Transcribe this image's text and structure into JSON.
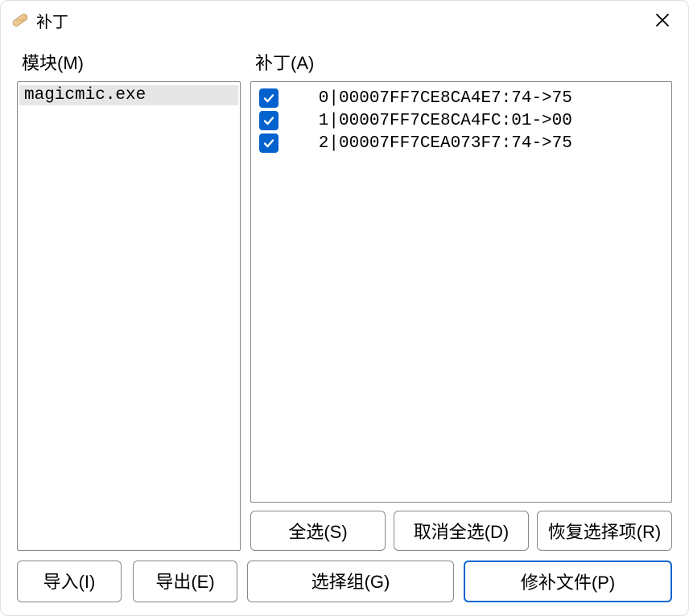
{
  "window": {
    "title": "补丁"
  },
  "modules": {
    "label": "模块(M)",
    "items": [
      {
        "name": "magicmic.exe"
      }
    ]
  },
  "patches": {
    "label": "补丁(A)",
    "items": [
      {
        "checked": true,
        "text": "   0|00007FF7CE8CA4E7:74->75"
      },
      {
        "checked": true,
        "text": "   1|00007FF7CE8CA4FC:01->00"
      },
      {
        "checked": true,
        "text": "   2|00007FF7CEA073F7:74->75"
      }
    ]
  },
  "buttons": {
    "select_all": "全选(S)",
    "deselect_all": "取消全选(D)",
    "restore_selection": "恢复选择项(R)",
    "import": "导入(I)",
    "export": "导出(E)",
    "select_group": "选择组(G)",
    "patch_file": "修补文件(P)"
  }
}
